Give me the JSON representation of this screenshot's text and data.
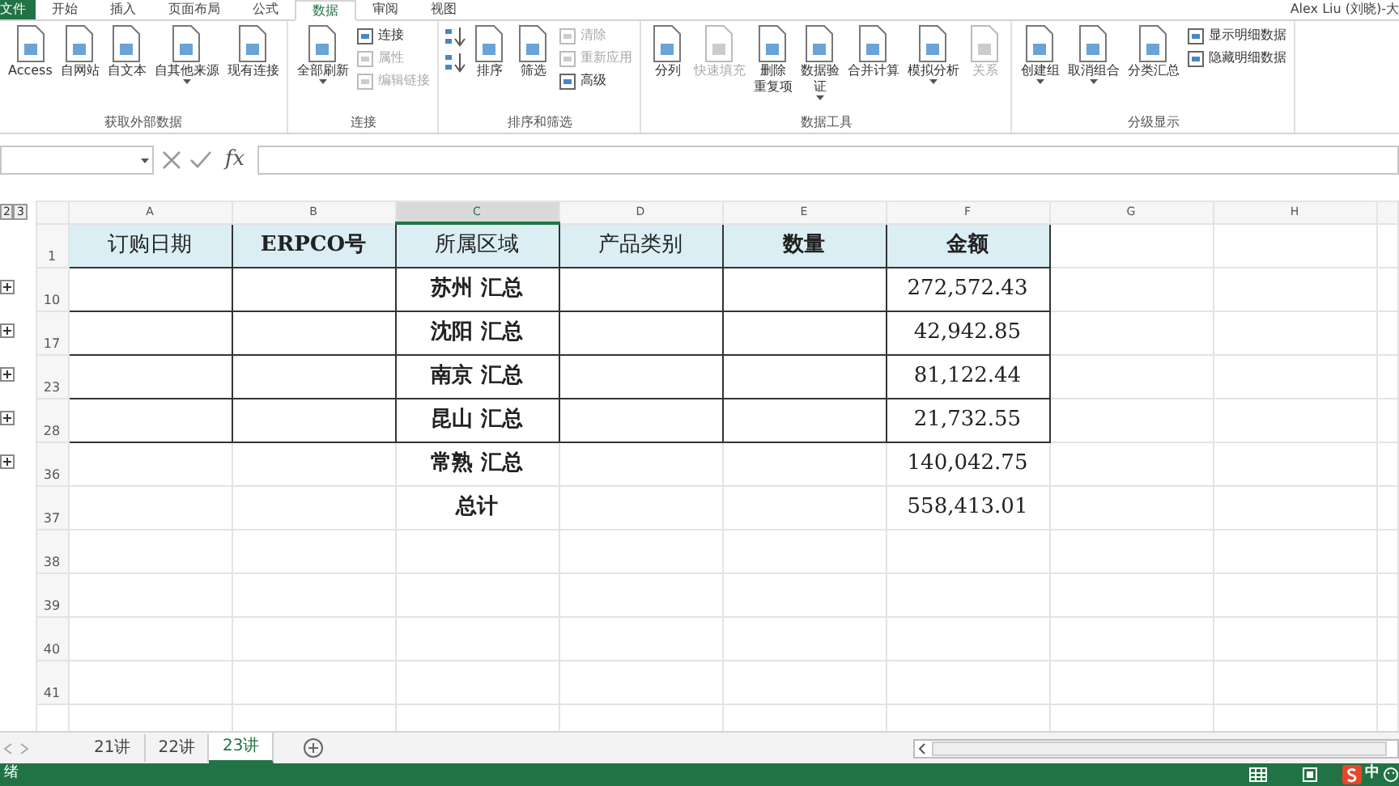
{
  "ribbon": {
    "tabs": [
      {
        "label": "文件",
        "kind": "file",
        "selected": false
      },
      {
        "label": "开始",
        "kind": "tab",
        "selected": false
      },
      {
        "label": "插入",
        "kind": "tab",
        "selected": false
      },
      {
        "label": "页面布局",
        "kind": "tab",
        "selected": false
      },
      {
        "label": "公式",
        "kind": "tab",
        "selected": false
      },
      {
        "label": "数据",
        "kind": "tab",
        "selected": true
      },
      {
        "label": "审阅",
        "kind": "tab",
        "selected": false
      },
      {
        "label": "视图",
        "kind": "tab",
        "selected": false
      }
    ],
    "user": "Alex Liu (刘晓)-大",
    "groups": [
      {
        "label": "获取外部数据",
        "items": [
          {
            "kind": "large",
            "label": "Access",
            "disabled": false,
            "dropdown": false
          },
          {
            "kind": "large",
            "label": "自网站",
            "disabled": false,
            "dropdown": false
          },
          {
            "kind": "large",
            "label": "自文本",
            "disabled": false,
            "dropdown": false
          },
          {
            "kind": "large",
            "label": "自其他来源",
            "disabled": false,
            "dropdown": true
          },
          {
            "kind": "large",
            "label": "现有连接",
            "disabled": false,
            "dropdown": false
          }
        ]
      },
      {
        "label": "连接",
        "items": [
          {
            "kind": "large",
            "label": "全部刷新",
            "disabled": false,
            "dropdown": true
          },
          {
            "kind": "stack",
            "items": [
              {
                "label": "连接",
                "disabled": false
              },
              {
                "label": "属性",
                "disabled": true
              },
              {
                "label": "编辑链接",
                "disabled": true
              }
            ]
          }
        ]
      },
      {
        "label": "排序和筛选",
        "items": [
          {
            "kind": "sort_pair"
          },
          {
            "kind": "large",
            "label": "排序",
            "disabled": false,
            "dropdown": false
          },
          {
            "kind": "large",
            "label": "筛选",
            "disabled": false,
            "dropdown": false
          },
          {
            "kind": "stack",
            "items": [
              {
                "label": "清除",
                "disabled": true
              },
              {
                "label": "重新应用",
                "disabled": true
              },
              {
                "label": "高级",
                "disabled": false
              }
            ]
          }
        ]
      },
      {
        "label": "数据工具",
        "items": [
          {
            "kind": "large",
            "label": "分列",
            "disabled": false,
            "dropdown": false
          },
          {
            "kind": "large",
            "label": "快速填充",
            "disabled": true,
            "dropdown": false
          },
          {
            "kind": "large",
            "lines": [
              "删除",
              "重复项"
            ],
            "disabled": false,
            "dropdown": false
          },
          {
            "kind": "large",
            "lines": [
              "数据验",
              "证"
            ],
            "disabled": false,
            "dropdown": true
          },
          {
            "kind": "large",
            "label": "合并计算",
            "disabled": false,
            "dropdown": false
          },
          {
            "kind": "large",
            "label": "模拟分析",
            "disabled": false,
            "dropdown": true
          },
          {
            "kind": "large",
            "label": "关系",
            "disabled": true,
            "dropdown": false
          }
        ]
      },
      {
        "label": "分级显示",
        "items": [
          {
            "kind": "large",
            "label": "创建组",
            "disabled": false,
            "dropdown": true
          },
          {
            "kind": "large",
            "label": "取消组合",
            "disabled": false,
            "dropdown": true
          },
          {
            "kind": "large",
            "label": "分类汇总",
            "disabled": false,
            "dropdown": false
          },
          {
            "kind": "stack",
            "items": [
              {
                "label": "显示明细数据",
                "disabled": false
              },
              {
                "label": "隐藏明细数据",
                "disabled": false
              }
            ]
          }
        ]
      }
    ]
  },
  "formula_bar": {
    "fx_label": "fx"
  },
  "outline_levels": [
    "2",
    "3"
  ],
  "columns": [
    {
      "letter": "A",
      "selected": false
    },
    {
      "letter": "B",
      "selected": false
    },
    {
      "letter": "C",
      "selected": true
    },
    {
      "letter": "D",
      "selected": false
    },
    {
      "letter": "E",
      "selected": false
    },
    {
      "letter": "F",
      "selected": false
    },
    {
      "letter": "G",
      "selected": false
    },
    {
      "letter": "H",
      "selected": false
    }
  ],
  "rows": [
    {
      "number": "1",
      "header": true,
      "bordered": true,
      "outline_button": false,
      "cells": [
        {
          "text": "订购日期",
          "bold": false
        },
        {
          "text": "ERPCO号",
          "bold": true
        },
        {
          "text": "所属区域",
          "bold": false
        },
        {
          "text": "产品类别",
          "bold": false
        },
        {
          "text": "数量",
          "bold": true
        },
        {
          "text": "金额",
          "bold": true
        }
      ]
    },
    {
      "number": "10",
      "header": false,
      "bordered": true,
      "outline_button": true,
      "cells": [
        null,
        null,
        {
          "text": "苏州  汇总",
          "bold": true
        },
        null,
        null,
        {
          "text": "272,572.43",
          "bold": false
        }
      ]
    },
    {
      "number": "17",
      "header": false,
      "bordered": true,
      "outline_button": true,
      "cells": [
        null,
        null,
        {
          "text": "沈阳  汇总",
          "bold": true
        },
        null,
        null,
        {
          "text": "42,942.85",
          "bold": false
        }
      ]
    },
    {
      "number": "23",
      "header": false,
      "bordered": true,
      "outline_button": true,
      "cells": [
        null,
        null,
        {
          "text": "南京  汇总",
          "bold": true
        },
        null,
        null,
        {
          "text": "81,122.44",
          "bold": false
        }
      ]
    },
    {
      "number": "28",
      "header": false,
      "bordered": true,
      "outline_button": true,
      "cells": [
        null,
        null,
        {
          "text": "昆山  汇总",
          "bold": true
        },
        null,
        null,
        {
          "text": "21,732.55",
          "bold": false
        }
      ]
    },
    {
      "number": "36",
      "header": false,
      "bordered": false,
      "outline_button": true,
      "cells": [
        null,
        null,
        {
          "text": "常熟  汇总",
          "bold": true
        },
        null,
        null,
        {
          "text": "140,042.75",
          "bold": false
        }
      ]
    },
    {
      "number": "37",
      "header": false,
      "bordered": false,
      "outline_button": false,
      "cells": [
        null,
        null,
        {
          "text": "总计",
          "bold": true
        },
        null,
        null,
        {
          "text": "558,413.01",
          "bold": false
        }
      ]
    },
    {
      "number": "38",
      "header": false,
      "bordered": false,
      "outline_button": false,
      "cells": []
    },
    {
      "number": "39",
      "header": false,
      "bordered": false,
      "outline_button": false,
      "cells": []
    },
    {
      "number": "40",
      "header": false,
      "bordered": false,
      "outline_button": false,
      "cells": []
    },
    {
      "number": "41",
      "header": false,
      "bordered": false,
      "outline_button": false,
      "cells": []
    }
  ],
  "sheet_tabs": [
    {
      "label": "21讲",
      "selected": false
    },
    {
      "label": "22讲",
      "selected": false
    },
    {
      "label": "23讲",
      "selected": true
    }
  ],
  "status_bar": {
    "text": "绪",
    "ime": "中"
  }
}
